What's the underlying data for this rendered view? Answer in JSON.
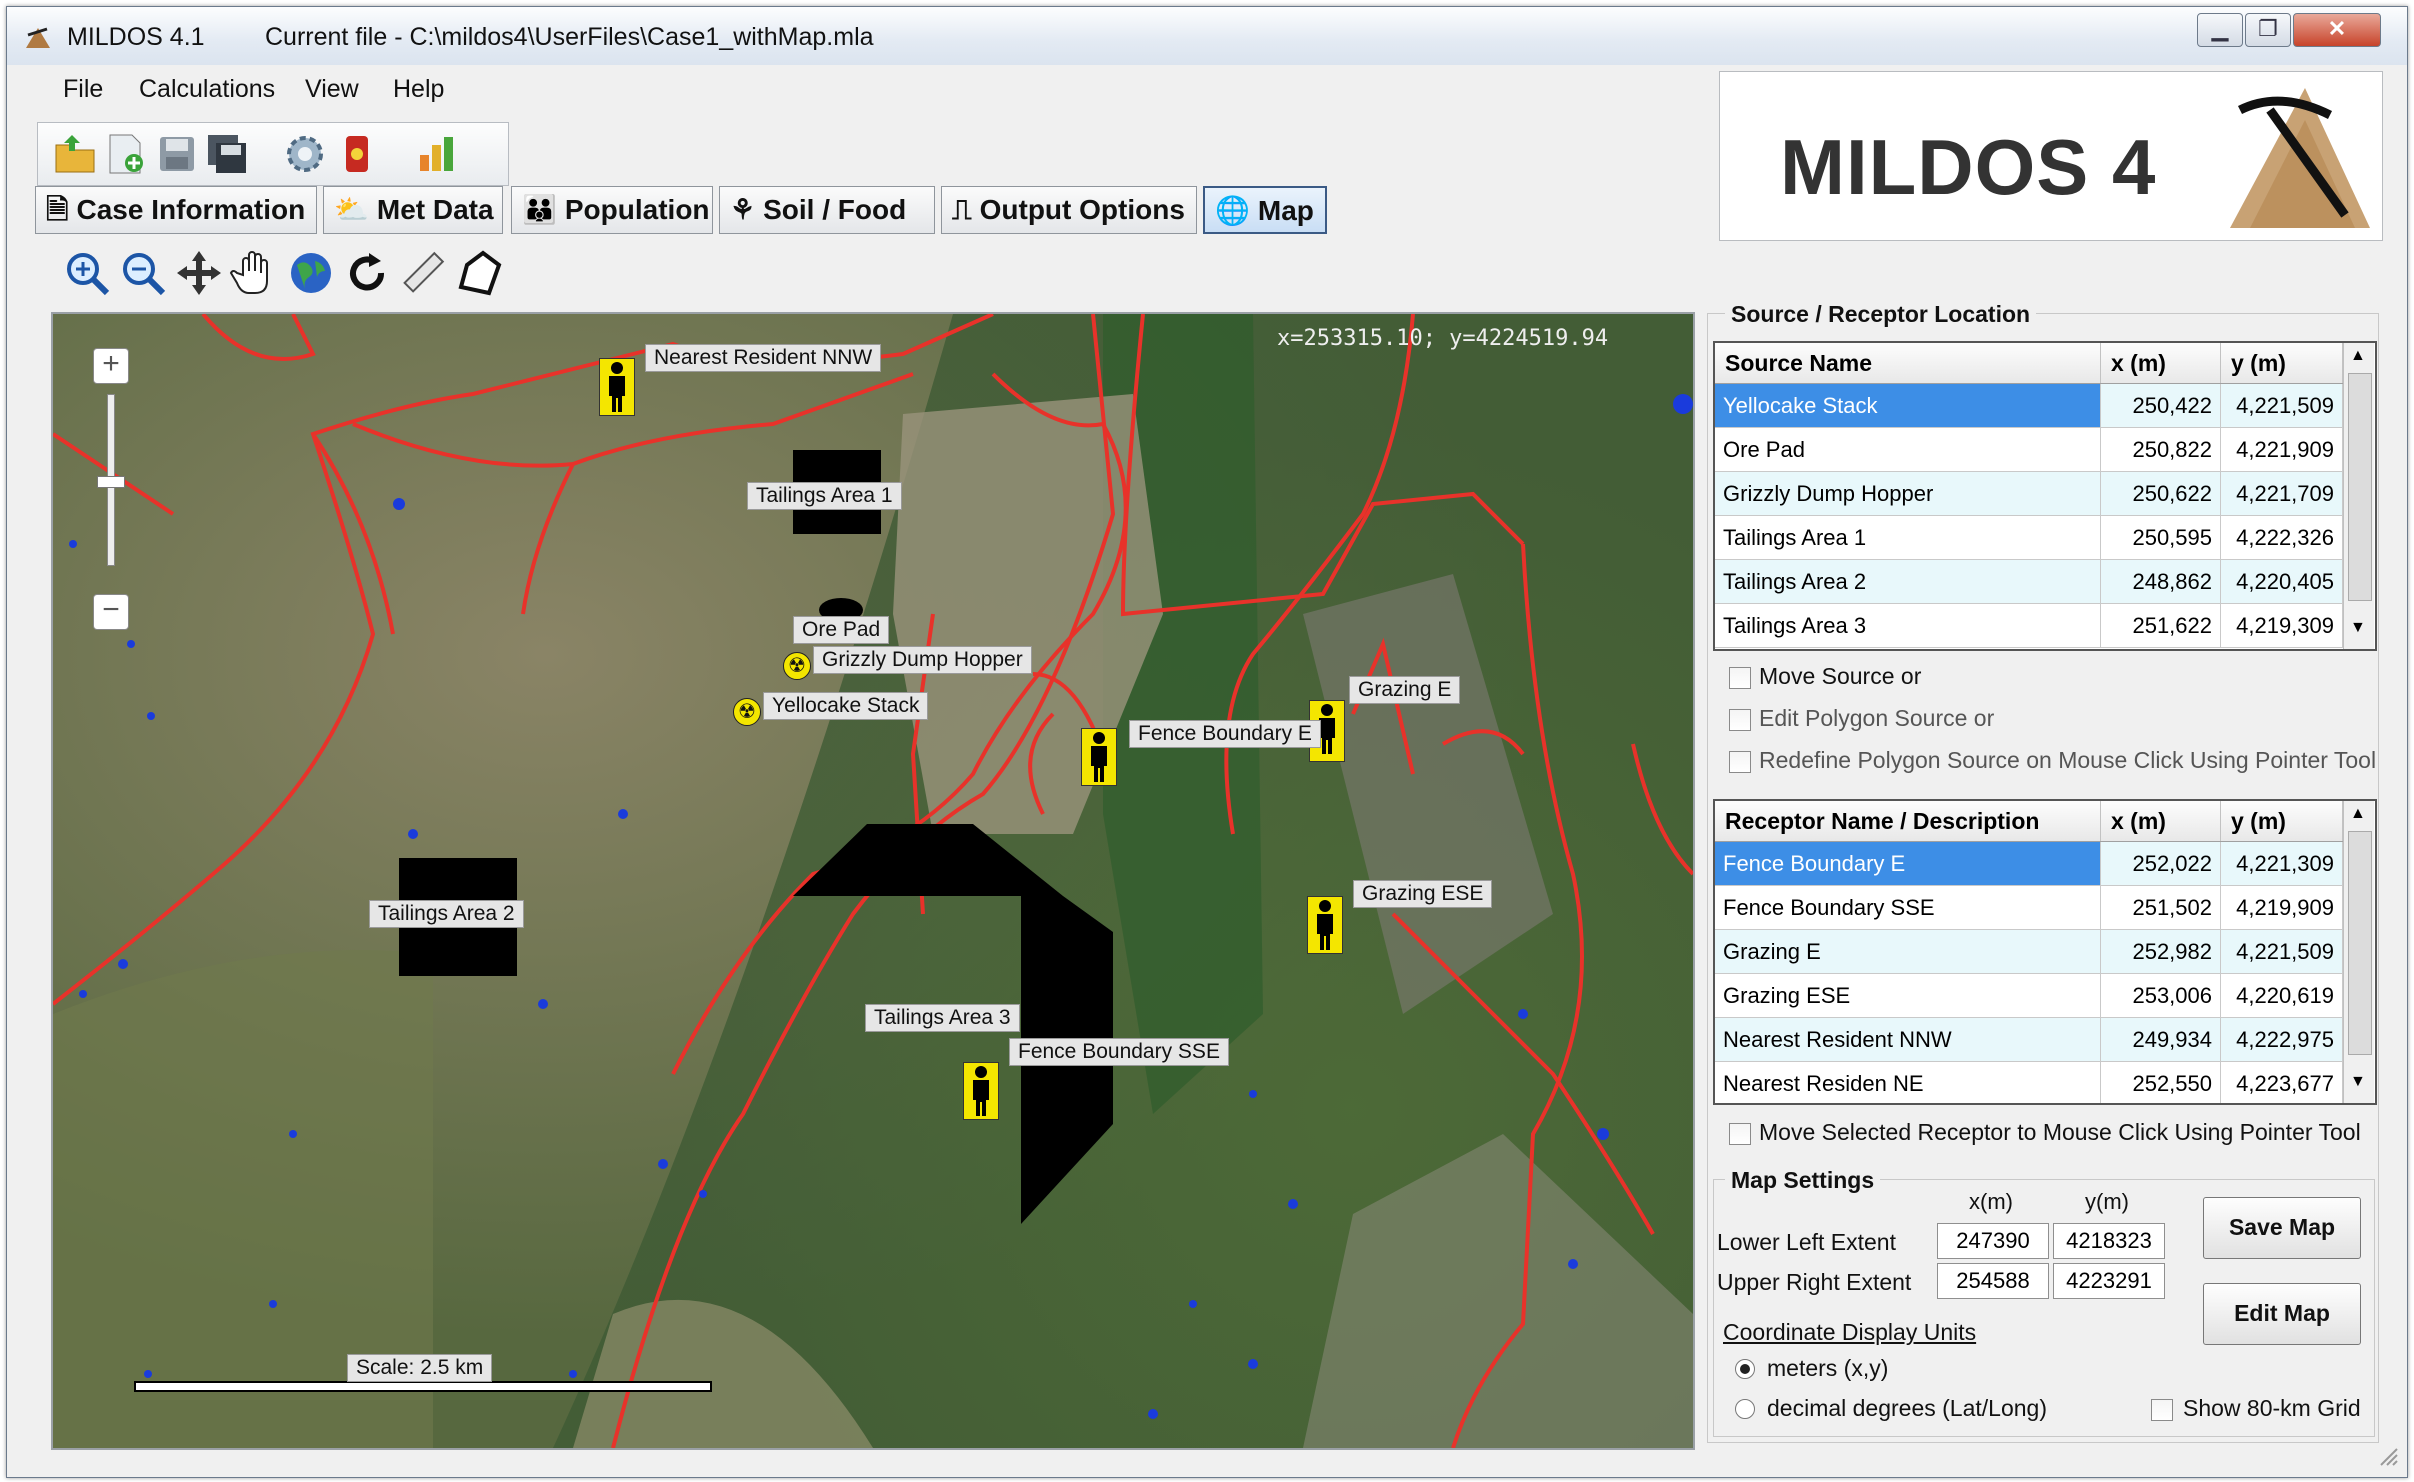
{
  "window": {
    "app_title": "MILDOS 4.1",
    "current_file": "Current file - C:\\mildos4\\UserFiles\\Case1_withMap.mla",
    "controls": {
      "minimize": "▁",
      "restore": "❐",
      "close": "✕"
    }
  },
  "menu": [
    "File",
    "Calculations",
    "View",
    "Help"
  ],
  "toolbar_icons": [
    "open-folder-icon",
    "new-file-icon",
    "save-icon",
    "save-all-icon",
    "settings-gear-icon",
    "radiation-drum-icon",
    "bar-chart-icon"
  ],
  "tabs": [
    {
      "label": "Case Information",
      "icon": "document-icon",
      "active": false
    },
    {
      "label": "Met Data",
      "icon": "weather-icon",
      "active": false
    },
    {
      "label": "Population",
      "icon": "people-icon",
      "active": false
    },
    {
      "label": "Soil / Food",
      "icon": "plant-icon",
      "active": false
    },
    {
      "label": "Output Options",
      "icon": "output-icon",
      "active": false
    },
    {
      "label": "Map",
      "icon": "globe-icon",
      "active": true
    }
  ],
  "logo": {
    "text": "MILDOS 4"
  },
  "map_tools": [
    "zoom-in-icon",
    "zoom-out-icon",
    "pan-arrows-icon",
    "hand-icon",
    "globe-icon",
    "refresh-icon",
    "ruler-icon",
    "polygon-icon"
  ],
  "map": {
    "coordinate_readout": "x=253315.10; y=4224519.94",
    "zoom_in": "+",
    "zoom_out": "−",
    "scale_label": "Scale: 2.5 km",
    "labels": {
      "nearest_resident_nnw": "Nearest Resident NNW",
      "tailings_area_1": "Tailings Area 1",
      "ore_pad": "Ore Pad",
      "grizzly_dump_hopper": "Grizzly Dump Hopper",
      "yellocake_stack": "Yellocake Stack",
      "fence_boundary_e": "Fence Boundary E",
      "grazing_e": "Grazing E",
      "tailings_area_2": "Tailings Area 2",
      "grazing_ese": "Grazing ESE",
      "tailings_area_3": "Tailings Area 3",
      "fence_boundary_sse": "Fence Boundary SSE"
    },
    "colors": {
      "roads": "#e8322a",
      "water": "#1a3bdc",
      "marker": "#f4e600"
    }
  },
  "source_panel": {
    "title": "Source / Receptor Location",
    "columns": [
      "Source Name",
      "x (m)",
      "y (m)"
    ],
    "rows": [
      {
        "name": "Yellocake Stack",
        "x": "250,422",
        "y": "4,221,509"
      },
      {
        "name": "Ore Pad",
        "x": "250,822",
        "y": "4,221,909"
      },
      {
        "name": "Grizzly Dump Hopper",
        "x": "250,622",
        "y": "4,221,709"
      },
      {
        "name": "Tailings Area 1",
        "x": "250,595",
        "y": "4,222,326"
      },
      {
        "name": "Tailings Area 2",
        "x": "248,862",
        "y": "4,220,405"
      },
      {
        "name": "Tailings Area 3",
        "x": "251,622",
        "y": "4,219,309"
      }
    ],
    "selected_row": 0,
    "options": {
      "move_source": "Move Source or",
      "edit_polygon": "Edit Polygon Source or",
      "redefine_polygon": "Redefine Polygon Source on Mouse Click Using Pointer Tool"
    }
  },
  "receptor_panel": {
    "columns": [
      "Receptor Name / Description",
      "x (m)",
      "y (m)"
    ],
    "rows": [
      {
        "name": "Fence Boundary E",
        "x": "252,022",
        "y": "4,221,309"
      },
      {
        "name": "Fence Boundary SSE",
        "x": "251,502",
        "y": "4,219,909"
      },
      {
        "name": "Grazing E",
        "x": "252,982",
        "y": "4,221,509"
      },
      {
        "name": "Grazing ESE",
        "x": "253,006",
        "y": "4,220,619"
      },
      {
        "name": "Nearest Resident NNW",
        "x": "249,934",
        "y": "4,222,975"
      },
      {
        "name": "Nearest Residen NE",
        "x": "252,550",
        "y": "4,223,677"
      }
    ],
    "selected_row": 0,
    "move_option": "Move Selected Receptor to Mouse Click Using Pointer Tool"
  },
  "map_settings": {
    "title": "Map Settings",
    "col_x": "x(m)",
    "col_y": "y(m)",
    "lower_left_label": "Lower Left Extent",
    "lower_left_x": "247390",
    "lower_left_y": "4218323",
    "upper_right_label": "Upper Right Extent",
    "upper_right_x": "254588",
    "upper_right_y": "4223291",
    "save_map": "Save Map",
    "edit_map": "Edit Map",
    "units_title": "Coordinate Display Units",
    "unit_meters": "meters (x,y)",
    "unit_degrees": "decimal degrees (Lat/Long)",
    "selected_unit": "meters",
    "show_grid": "Show 80-km Grid"
  },
  "scroll_arrows": {
    "up": "▲",
    "down": "▼"
  }
}
